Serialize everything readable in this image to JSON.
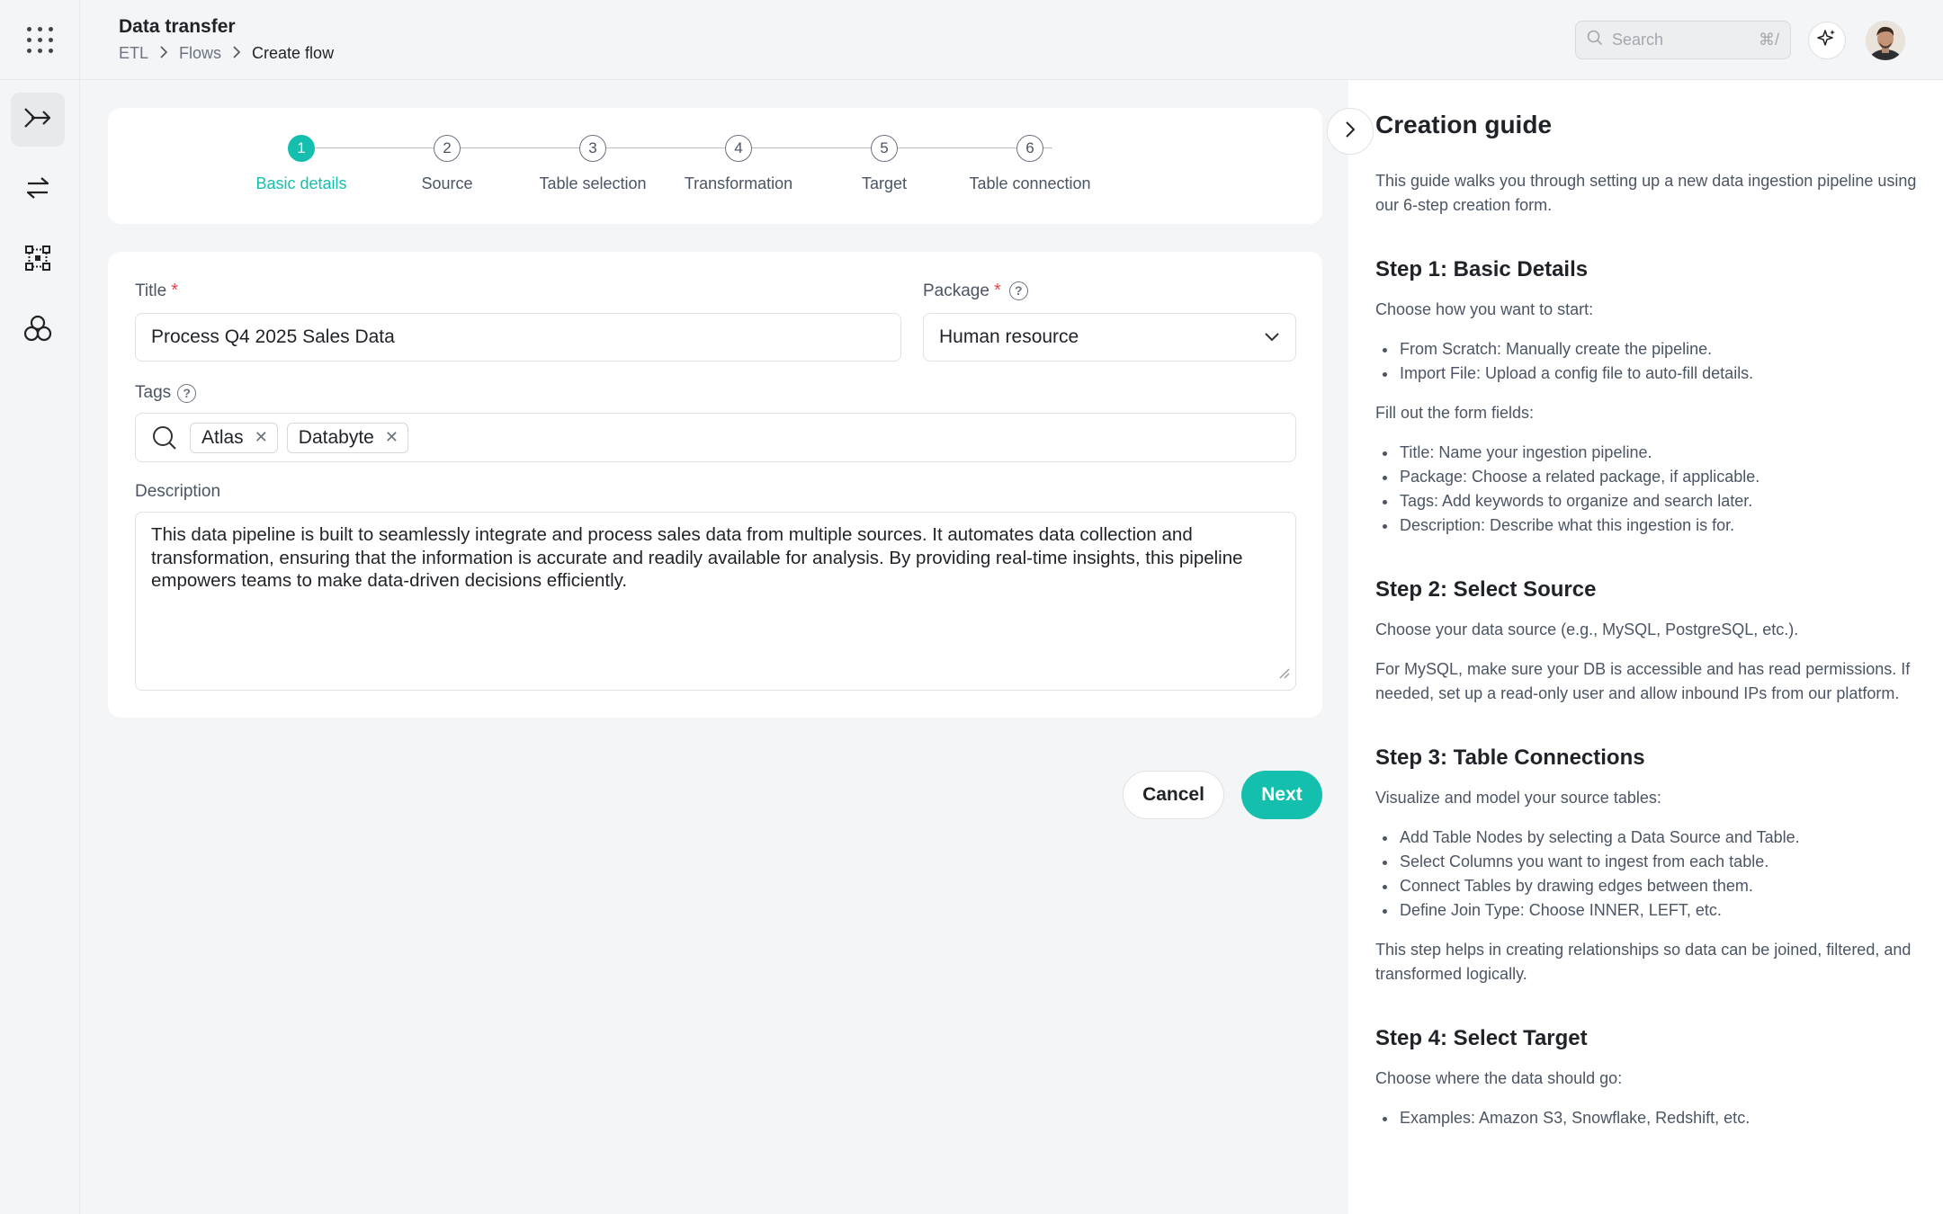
{
  "header": {
    "title": "Data transfer",
    "breadcrumb": [
      "ETL",
      "Flows",
      "Create flow"
    ],
    "search_placeholder": "Search",
    "search_shortcut": "⌘/"
  },
  "stepper": {
    "steps": [
      {
        "num": "1",
        "label": "Basic details"
      },
      {
        "num": "2",
        "label": "Source"
      },
      {
        "num": "3",
        "label": "Table selection"
      },
      {
        "num": "4",
        "label": "Transformation"
      },
      {
        "num": "5",
        "label": "Target"
      },
      {
        "num": "6",
        "label": "Table connection"
      }
    ],
    "active_index": 0
  },
  "form": {
    "title_label": "Title",
    "title_value": "Process Q4 2025 Sales Data",
    "package_label": "Package",
    "package_value": "Human resource",
    "tags_label": "Tags",
    "tags": [
      "Atlas",
      "Databyte"
    ],
    "description_label": "Description",
    "description_value": "This data pipeline is built to seamlessly integrate and process sales data from multiple sources. It automates data collection and transformation, ensuring that the information is accurate and readily available for analysis. By providing real-time insights, this pipeline empowers teams to make data-driven decisions efficiently."
  },
  "actions": {
    "cancel_label": "Cancel",
    "next_label": "Next"
  },
  "guide": {
    "title": "Creation guide",
    "intro": "This guide walks you through setting up a new data ingestion pipeline using our 6-step creation form.",
    "step1": {
      "heading": "Step 1: Basic Details",
      "p1": "Choose how you want to start:",
      "list1": [
        "From Scratch: Manually create the pipeline.",
        "Import File: Upload a config file to auto-fill details."
      ],
      "p2": "Fill out the form fields:",
      "list2": [
        "Title: Name your ingestion pipeline.",
        "Package: Choose a related package, if applicable.",
        "Tags: Add keywords to organize and search later.",
        "Description: Describe what this ingestion is for."
      ]
    },
    "step2": {
      "heading": "Step 2: Select Source",
      "p1": "Choose your data source (e.g., MySQL, PostgreSQL, etc.).",
      "p2": "For MySQL, make sure your DB is accessible and has read permissions. If needed, set up a read-only user and allow inbound IPs from our platform."
    },
    "step3": {
      "heading": "Step 3: Table Connections",
      "p1": "Visualize and model your source tables:",
      "list": [
        "Add Table Nodes by selecting a Data Source and Table.",
        "Select Columns you want to ingest from each table.",
        "Connect Tables by drawing edges between them.",
        "Define Join Type: Choose INNER, LEFT, etc."
      ],
      "p2": "This step helps in creating relationships so data can be joined, filtered, and transformed logically."
    },
    "step4": {
      "heading": "Step 4: Select Target",
      "p1": "Choose where the data should go:",
      "list": [
        "Examples: Amazon S3, Snowflake, Redshift, etc."
      ]
    }
  },
  "colors": {
    "accent": "#14bfae",
    "required": "#e5484d"
  }
}
